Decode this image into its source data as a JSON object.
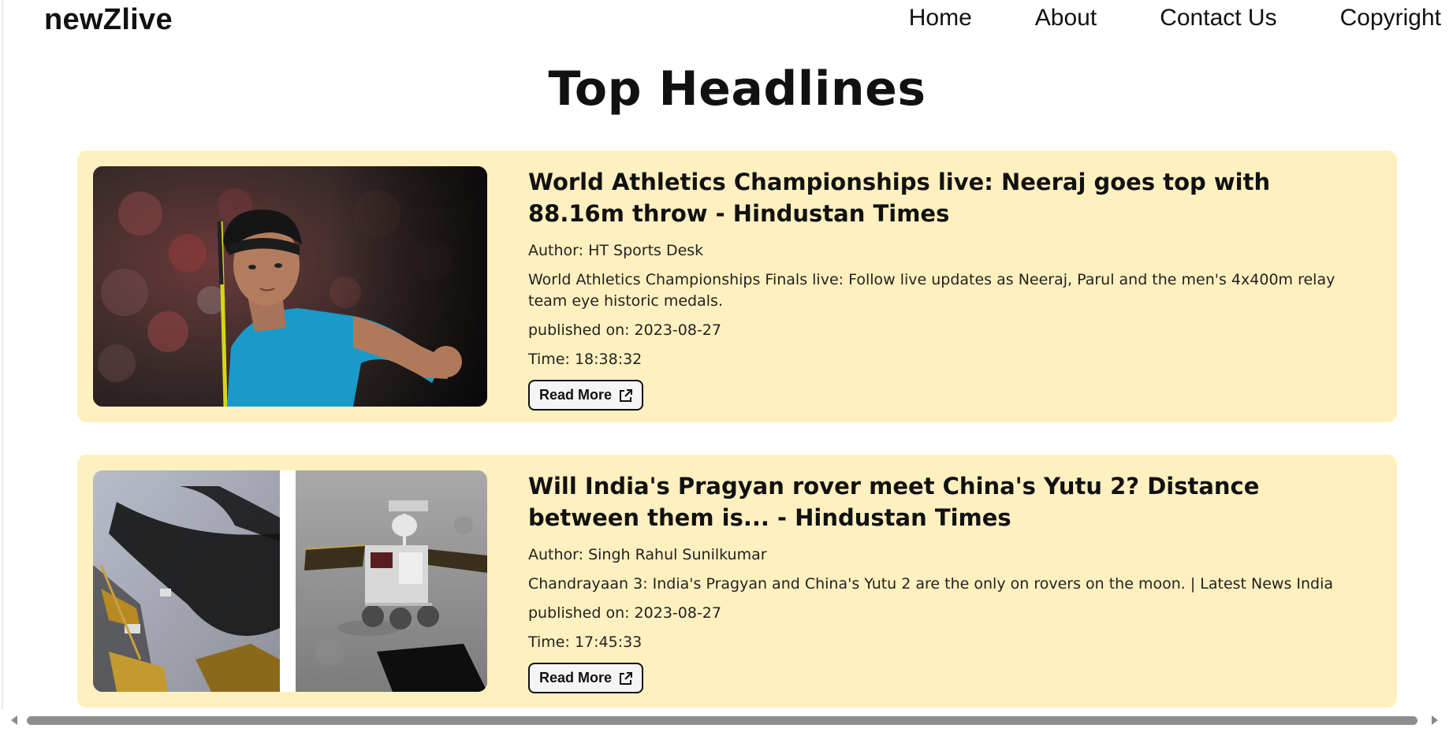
{
  "brand": "newZlive",
  "nav": [
    {
      "label": "Home"
    },
    {
      "label": "About"
    },
    {
      "label": "Contact Us"
    },
    {
      "label": "Copyright"
    }
  ],
  "page_title": "Top Headlines",
  "articles": [
    {
      "title": "World Athletics Championships live: Neeraj goes top with 88.16m throw - Hindustan Times",
      "author": "Author: HT Sports Desk",
      "description": "World Athletics Championships Finals live: Follow live updates as Neeraj, Parul and the men's 4x400m relay team eye historic medals.",
      "published": "published on: 2023-08-27",
      "time": "Time: 18:38:32",
      "read_more": "Read More"
    },
    {
      "title": "Will India's Pragyan rover meet China's Yutu 2? Distance between them is... - Hindustan Times",
      "author": "Author: Singh Rahul Sunilkumar",
      "description": "Chandrayaan 3: India's Pragyan and China's Yutu 2 are the only on rovers on the moon. | Latest News India",
      "published": "published on: 2023-08-27",
      "time": "Time: 17:45:33",
      "read_more": "Read More"
    }
  ],
  "colors": {
    "card_background": "#fff0bf",
    "button_background": "#f5f5f5",
    "text": "#111111"
  }
}
